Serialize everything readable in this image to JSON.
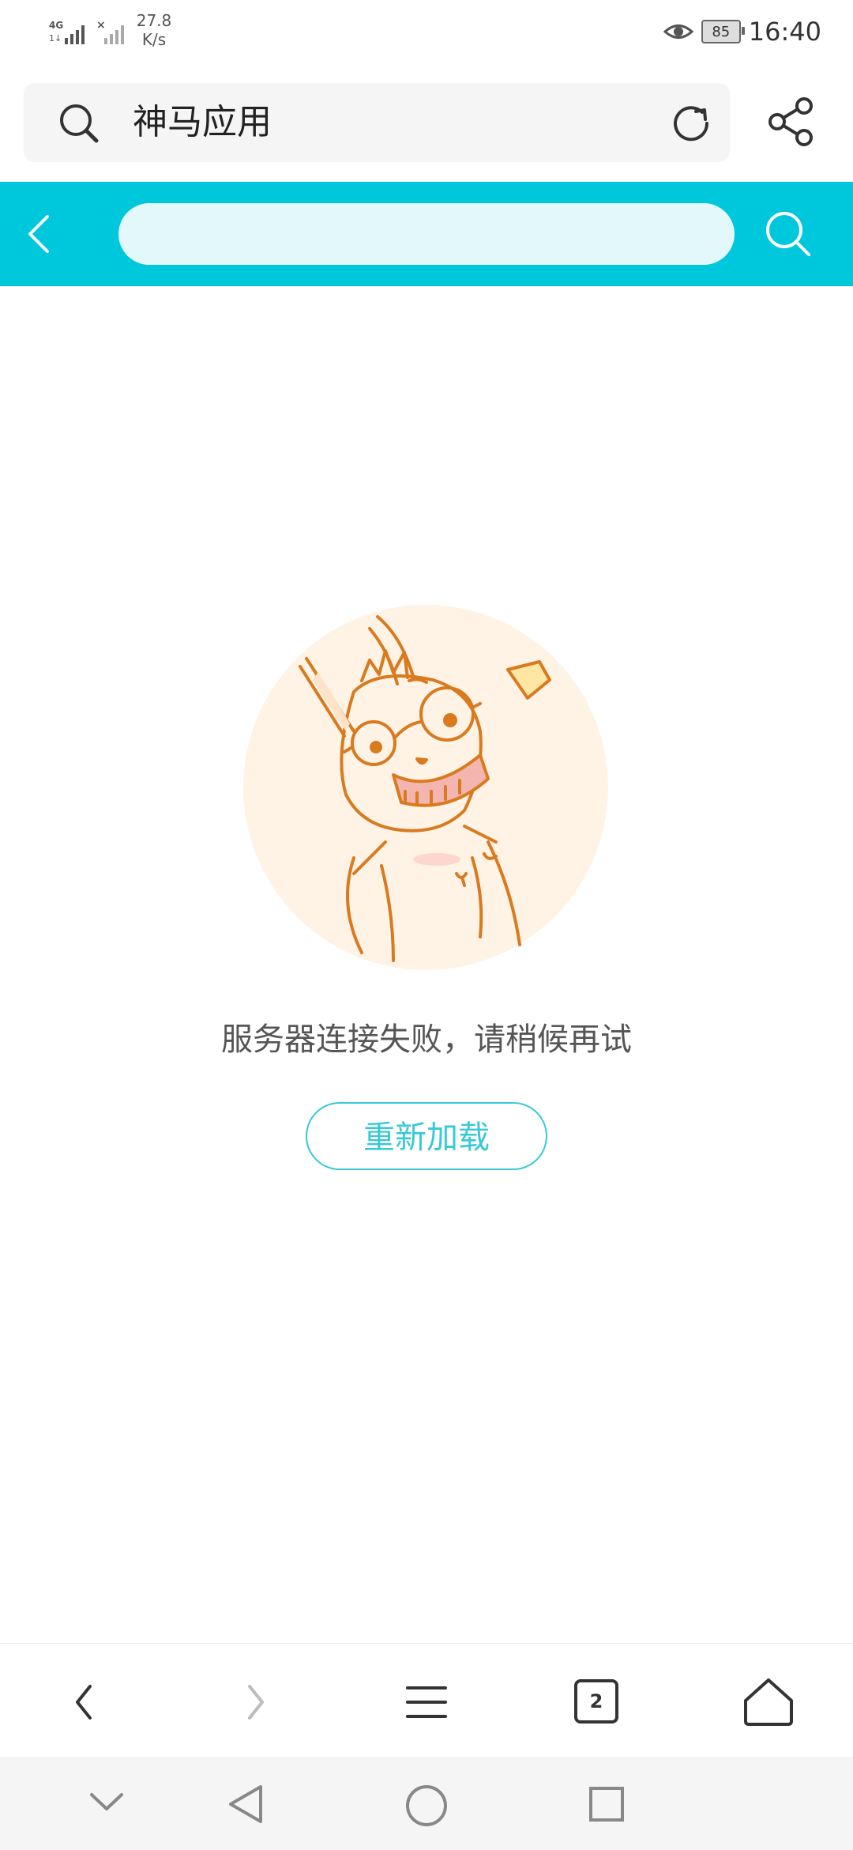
{
  "status_bar": {
    "network_speed_value": "27.8",
    "network_speed_unit": "K/s",
    "battery": "85",
    "time": "16:40"
  },
  "browser": {
    "address_text": "神马应用"
  },
  "site_header": {
    "search_placeholder": ""
  },
  "error": {
    "message": "服务器连接失败，请稍候再试",
    "reload_label": "重新加载"
  },
  "toolbar": {
    "tab_count": "2"
  },
  "colors": {
    "accent": "#00c8dc",
    "reload_border": "#36c9d6",
    "illustration_orange": "#d97a1f"
  },
  "icons": {
    "status": [
      "4g-signal-icon",
      "no-sim-signal-icon",
      "eye-icon",
      "battery-icon"
    ],
    "address_bar": [
      "search-icon",
      "refresh-icon",
      "share-icon"
    ],
    "site_header": [
      "back-arrow-icon",
      "search-icon"
    ],
    "toolbar": [
      "back-icon",
      "forward-icon",
      "menu-icon",
      "tabs-icon",
      "home-icon"
    ],
    "system_nav": [
      "collapse-icon",
      "nav-back-icon",
      "nav-home-icon",
      "nav-recents-icon"
    ]
  }
}
